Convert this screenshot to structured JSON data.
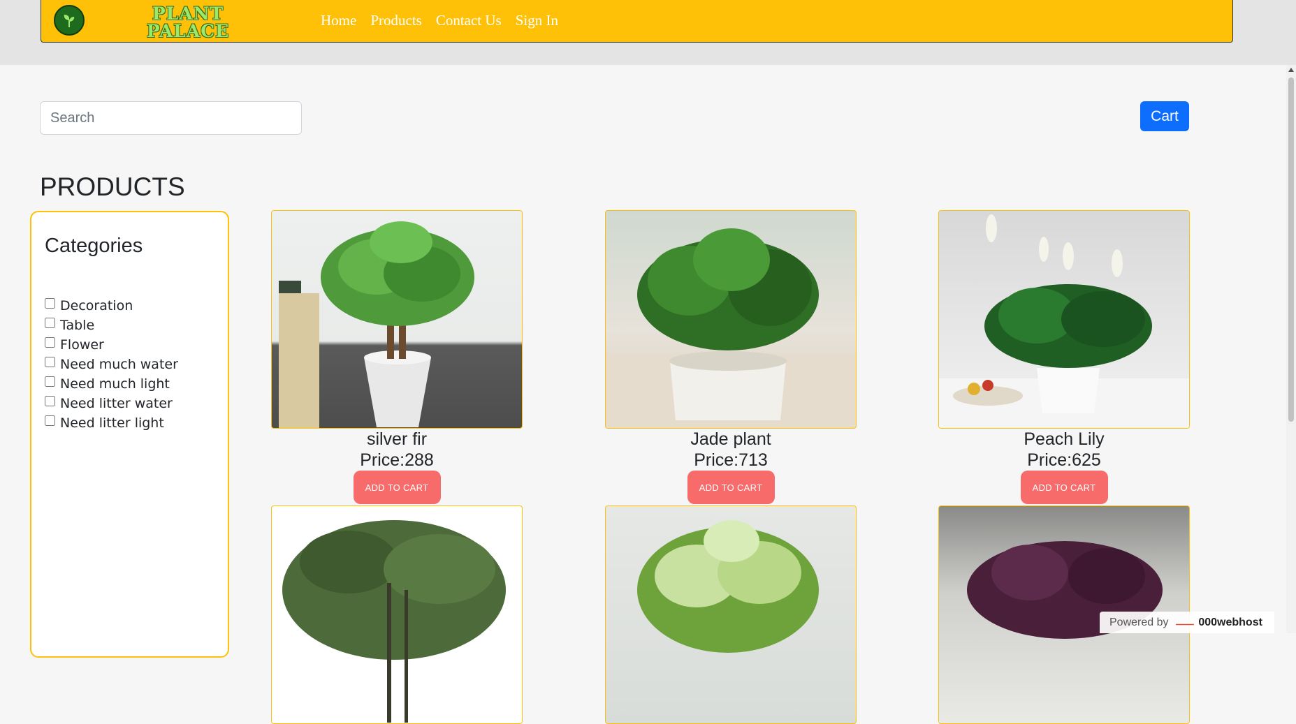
{
  "brand": {
    "line1": "PLANT",
    "line2": "PALACE"
  },
  "nav": {
    "items": [
      "Home",
      "Products",
      "Contact Us",
      "Sign In"
    ]
  },
  "search": {
    "placeholder": "Search"
  },
  "cart": {
    "label": "Cart"
  },
  "page_title": "PRODUCTS",
  "categories": {
    "title": "Categories",
    "items": [
      "Decoration",
      "Table",
      "Flower",
      "Need much water",
      "Need much light",
      "Need litter water",
      "Need litter light"
    ]
  },
  "products": [
    {
      "name": "silver fir",
      "price": "Price:288",
      "button": "ADD TO CART"
    },
    {
      "name": "Jade plant",
      "price": "Price:713",
      "button": "ADD TO CART"
    },
    {
      "name": "Peach Lily",
      "price": "Price:625",
      "button": "ADD TO CART"
    }
  ],
  "footer_badge": {
    "prefix": "Powered by",
    "host": "000webhost"
  },
  "colors": {
    "navbar": "#ffc107",
    "cart_button": "#0d6efd",
    "add_button": "#f76b6b",
    "border_accent": "#ffc107"
  }
}
